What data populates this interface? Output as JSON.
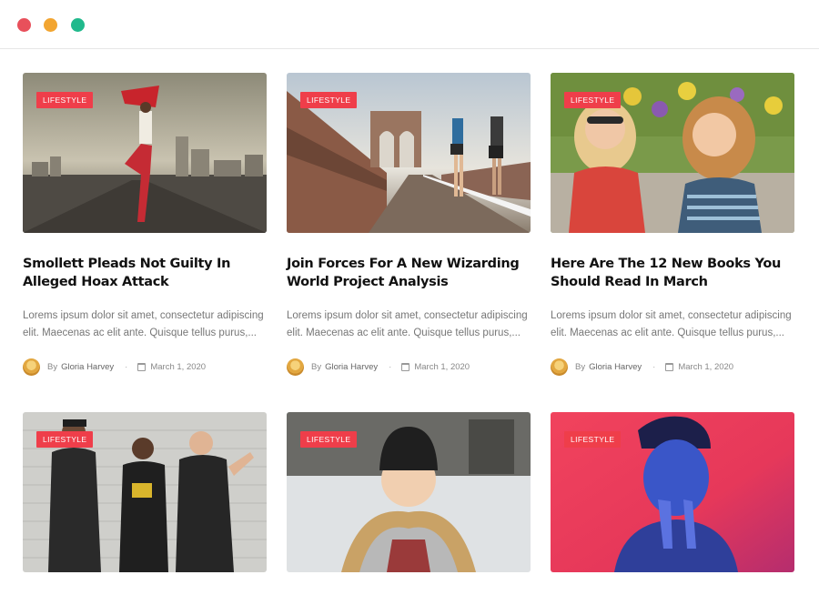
{
  "window": {
    "controls": [
      "close",
      "minimize",
      "maximize"
    ]
  },
  "colors": {
    "badge": "#ef3e4a",
    "title": "#111111",
    "excerpt": "#777777"
  },
  "posts": [
    {
      "category": "LIFESTYLE",
      "title": "Smollett Pleads Not Guilty In Alleged Hoax Attack",
      "excerpt": "Lorems ipsum dolor sit amet, consectetur adipiscing elit. Maecenas ac elit ante. Quisque tellus purus,...",
      "by": "By",
      "author": "Gloria Harvey",
      "date": "March 1, 2020"
    },
    {
      "category": "LIFESTYLE",
      "title": "Join Forces For A New Wizarding World Project Analysis",
      "excerpt": "Lorems ipsum dolor sit amet, consectetur adipiscing elit. Maecenas ac elit ante. Quisque tellus purus,...",
      "by": "By",
      "author": "Gloria Harvey",
      "date": "March 1, 2020"
    },
    {
      "category": "LIFESTYLE",
      "title": "Here Are The 12 New Books You Should Read In March",
      "excerpt": "Lorems ipsum dolor sit amet, consectetur adipiscing elit. Maecenas ac elit ante. Quisque tellus purus,...",
      "by": "By",
      "author": "Gloria Harvey",
      "date": "March 1, 2020"
    },
    {
      "category": "LIFESTYLE"
    },
    {
      "category": "LIFESTYLE"
    },
    {
      "category": "LIFESTYLE"
    }
  ]
}
